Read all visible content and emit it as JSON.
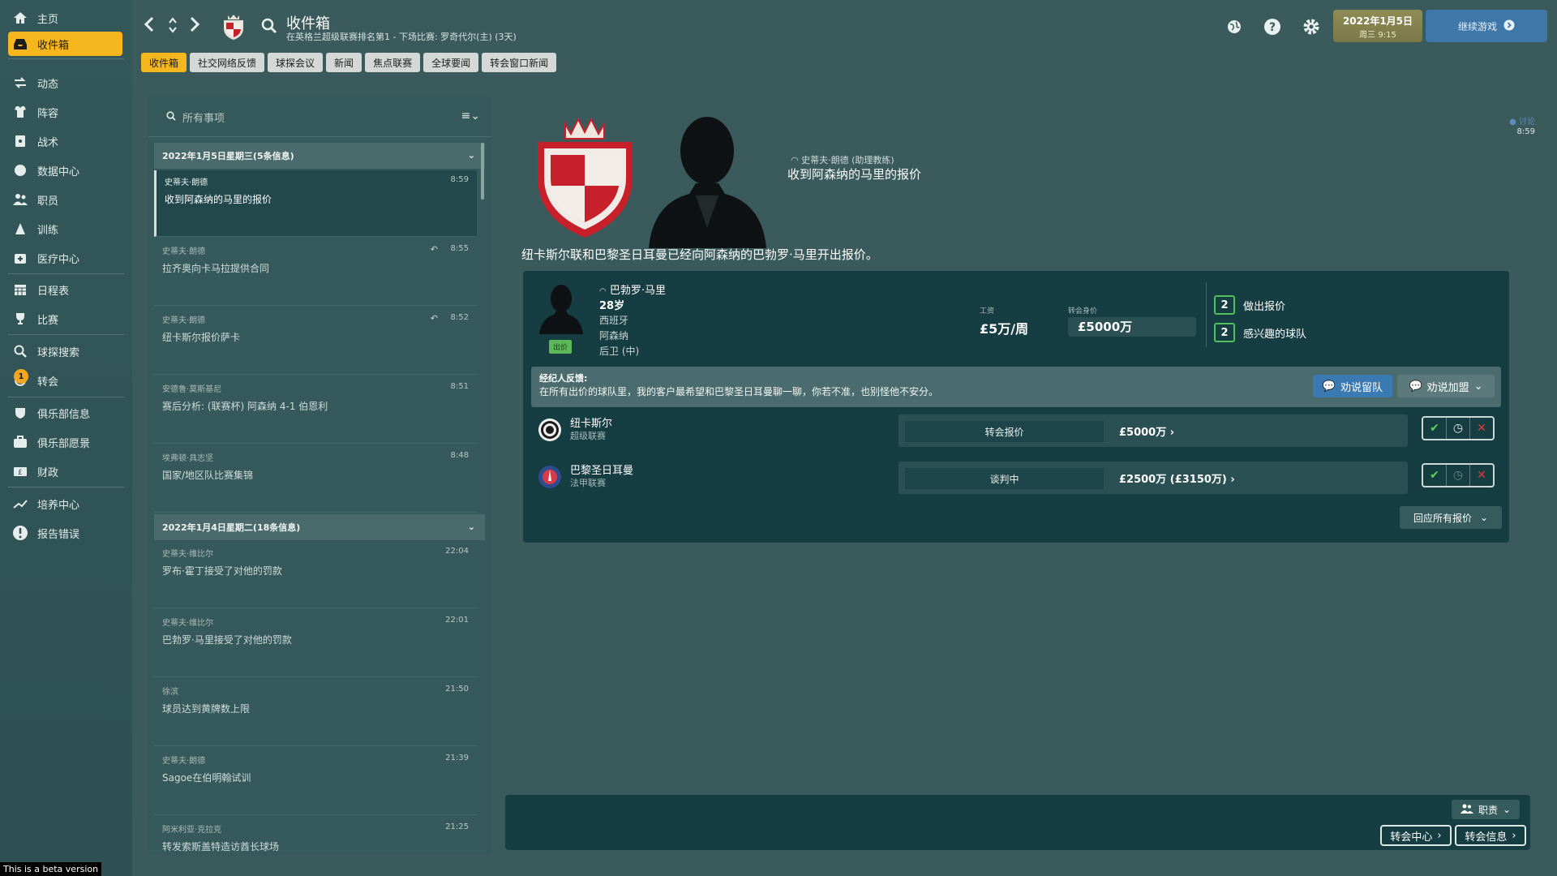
{
  "sidebar": {
    "items": [
      {
        "label": "主页",
        "icon": "home-icon"
      },
      {
        "label": "收件箱",
        "icon": "inbox-icon",
        "active": true
      },
      {
        "label": "动态",
        "icon": "dynamics-icon"
      },
      {
        "label": "阵容",
        "icon": "squad-icon"
      },
      {
        "label": "战术",
        "icon": "tactics-icon"
      },
      {
        "label": "数据中心",
        "icon": "data-hub-icon"
      },
      {
        "label": "职员",
        "icon": "staff-icon"
      },
      {
        "label": "训练",
        "icon": "training-icon"
      },
      {
        "label": "医疗中心",
        "icon": "medical-icon"
      },
      {
        "label": "日程表",
        "icon": "calendar-icon"
      },
      {
        "label": "比赛",
        "icon": "trophy-icon"
      },
      {
        "label": "球探搜索",
        "icon": "search-icon"
      },
      {
        "label": "转会",
        "icon": "transfers-icon",
        "badge": "1"
      },
      {
        "label": "俱乐部信息",
        "icon": "shield-icon"
      },
      {
        "label": "俱乐部愿景",
        "icon": "vision-icon"
      },
      {
        "label": "财政",
        "icon": "finance-icon"
      },
      {
        "label": "培养中心",
        "icon": "development-icon"
      },
      {
        "label": "报告错误",
        "icon": "alert-icon"
      }
    ],
    "beta_notice": "This is a beta version"
  },
  "header": {
    "title": "收件箱",
    "subtitle": "在英格兰超级联赛排名第1 - 下场比赛: 罗奇代尔(主) (3天)",
    "date_main": "2022年1月5日",
    "date_sub": "周三 9:15",
    "continue_label": "继续游戏"
  },
  "tabs": [
    "收件箱",
    "社交网络反馈",
    "球探会议",
    "新闻",
    "焦点联赛",
    "全球要闻",
    "转会窗口新闻"
  ],
  "inbox": {
    "search_placeholder": "所有事项",
    "groups": [
      {
        "title": "2022年1月5日星期三(5条信息)"
      },
      {
        "title": "2022年1月4日星期二(18条信息)"
      }
    ],
    "messages": [
      {
        "sender": "史蒂夫·朗德",
        "time": "8:59",
        "subject": "收到阿森纳的马里的报价",
        "selected": true
      },
      {
        "sender": "史蒂夫·朗德",
        "time": "8:55",
        "subject": "拉齐奥向卡马拉提供合同",
        "replied": true
      },
      {
        "sender": "史蒂夫·朗德",
        "time": "8:52",
        "subject": "纽卡斯尔报价萨卡",
        "replied": true
      },
      {
        "sender": "安德鲁·莫斯基尼",
        "time": "8:51",
        "subject": "赛后分析: (联赛杯) 阿森纳 4-1 伯恩利"
      },
      {
        "sender": "埃弗顿·具志坚",
        "time": "8:48",
        "subject": "国家/地区队比赛集锦"
      },
      {
        "sender": "史蒂夫·维比尔",
        "time": "22:04",
        "subject": "罗布·霍丁接受了对他的罚款"
      },
      {
        "sender": "史蒂夫·维比尔",
        "time": "22:01",
        "subject": "巴勃罗·马里接受了对他的罚款"
      },
      {
        "sender": "徐滨",
        "time": "21:50",
        "subject": "球员达到黄牌数上限"
      },
      {
        "sender": "史蒂夫·朗德",
        "time": "21:39",
        "subject": "Sagoe在伯明翰试训"
      },
      {
        "sender": "阿米利亚·克拉克",
        "time": "21:25",
        "subject": "转发索斯盖特造访酋长球场"
      }
    ]
  },
  "detail": {
    "sender_role": "史蒂夫·朗德 (助理教练)",
    "subject": "收到阿森纳的马里的报价",
    "corner_tag": "讨论",
    "time": "8:59",
    "headline": "纽卡斯尔联和巴黎圣日耳曼已经向阿森纳的巴勃罗·马里开出报价。",
    "player": {
      "name": "巴勃罗·马里",
      "age": "28岁",
      "nation": "西班牙",
      "club": "阿森纳",
      "position": "后卫 (中)",
      "sale_tag": "出价"
    },
    "wage_label": "工资",
    "wage": "£5万/周",
    "value_label": "转会身价",
    "value": "£5000万",
    "stats": [
      {
        "count": "2",
        "label": "做出报价"
      },
      {
        "count": "2",
        "label": "感兴趣的球队"
      }
    ],
    "agent_title": "经纪人反馈:",
    "agent_text": "在所有出价的球队里，我的客户最希望和巴黎圣日耳曼聊一聊，你若不准，也别怪他不安分。",
    "btn_stay": "劝说留队",
    "btn_join": "劝说加盟",
    "offers": [
      {
        "club": "纽卡斯尔",
        "league": "超级联赛",
        "status": "转会报价",
        "amount": "£5000万"
      },
      {
        "club": "巴黎圣日耳曼",
        "league": "法甲联赛",
        "status": "谈判中",
        "amount": "£2500万 (£3150万)"
      }
    ],
    "reply_all": "回应所有报价"
  },
  "footer": {
    "staff_label": "职责",
    "transfer_centre": "转会中心",
    "transfer_info": "转会信息"
  },
  "colors": {
    "accent": "#f5b61e",
    "accept": "#5fd15a",
    "reject": "#e23a3a",
    "button_blue": "#3b79b3"
  }
}
